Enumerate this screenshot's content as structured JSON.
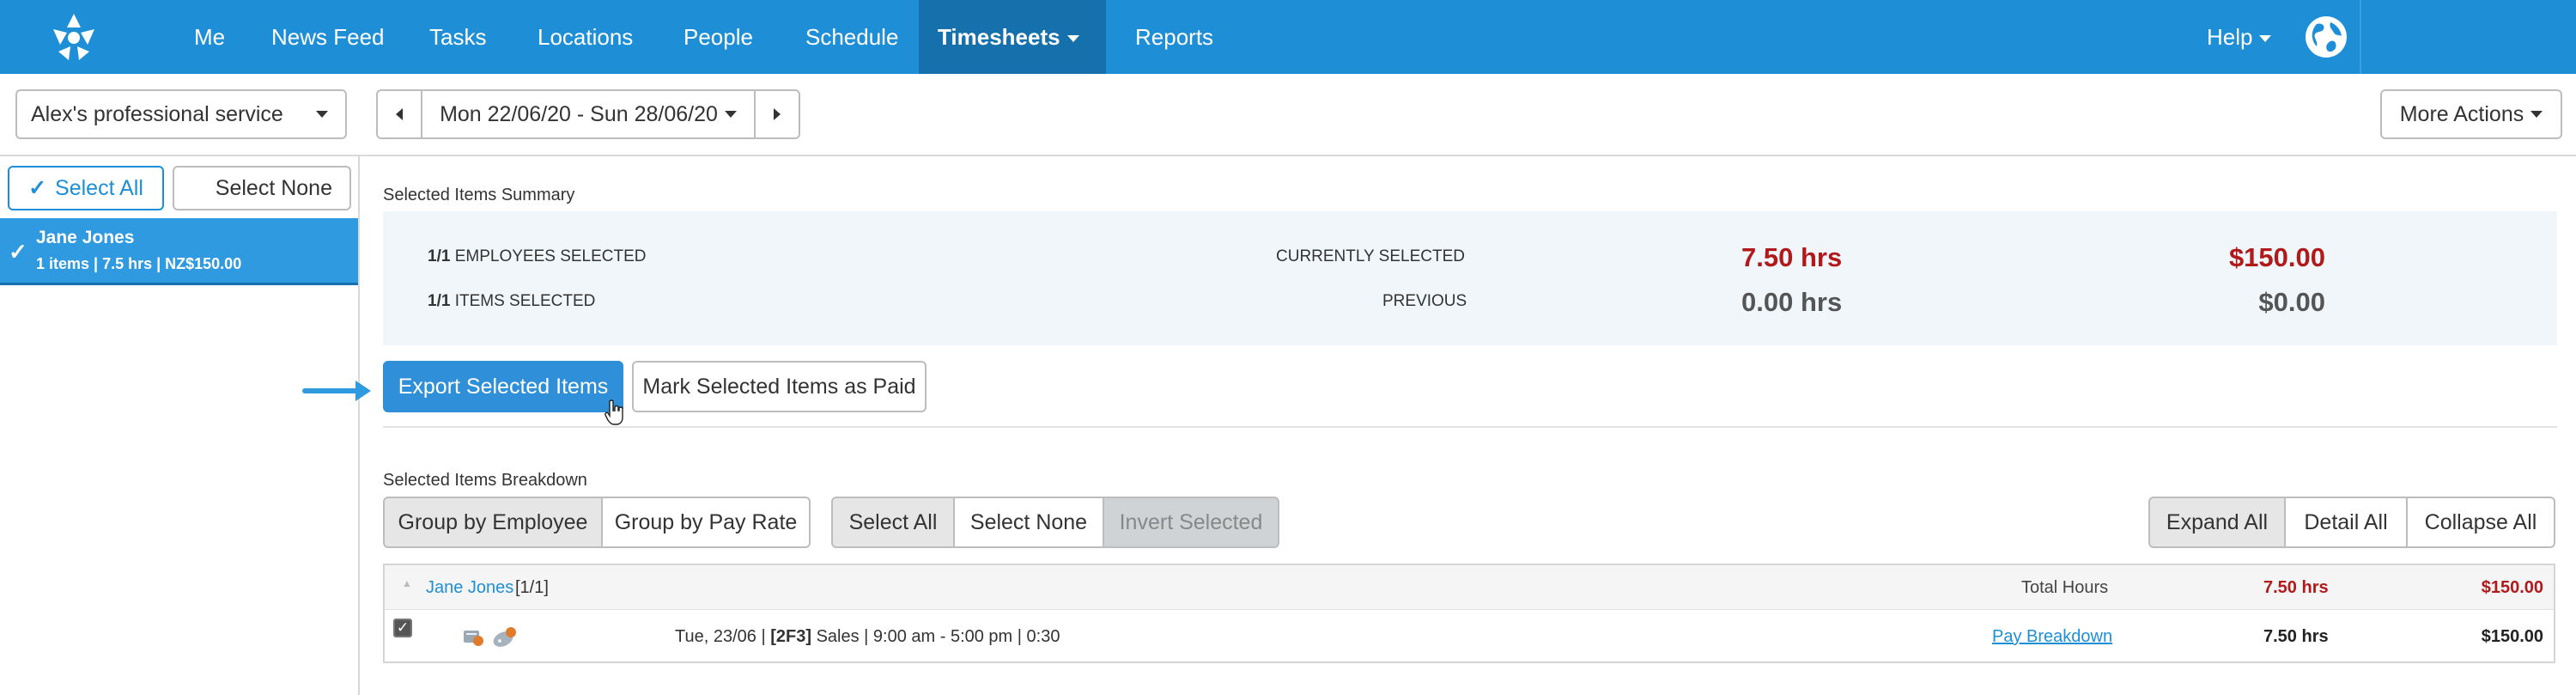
{
  "nav": {
    "items": [
      {
        "label": "Me"
      },
      {
        "label": "News Feed"
      },
      {
        "label": "Tasks"
      },
      {
        "label": "Locations"
      },
      {
        "label": "People"
      },
      {
        "label": "Schedule"
      },
      {
        "label": "Timesheets",
        "active": true,
        "dropdown": true
      },
      {
        "label": "Reports"
      }
    ],
    "help_label": "Help",
    "brand_color": "#1e8fd6",
    "active_color": "#1670ac"
  },
  "toolbar": {
    "business_select": "Alex's professional service",
    "date_range": "Mon 22/06/20 - Sun 28/06/20",
    "more_actions": "More Actions"
  },
  "sidebar": {
    "select_all": "Select All",
    "select_none": "Select None",
    "employees": [
      {
        "name": "Jane Jones",
        "summary": "1 items | 7.5 hrs | NZ$150.00",
        "selected": true
      }
    ]
  },
  "summary": {
    "title": "Selected Items Summary",
    "employees_count": "1/1",
    "employees_label": "Employees Selected",
    "items_count": "1/1",
    "items_label": "Items Selected",
    "currently_label": "Currently Selected",
    "previous_label": "Previous",
    "current_hours": "7.50 hrs",
    "current_amount": "$150.00",
    "previous_hours": "0.00 hrs",
    "previous_amount": "$0.00",
    "highlight_color": "#b01a1a"
  },
  "actions": {
    "export": "Export Selected Items",
    "mark_paid": "Mark Selected Items as Paid"
  },
  "breakdown": {
    "title": "Selected Items Breakdown",
    "group_by_employee": "Group by Employee",
    "group_by_pay_rate": "Group by Pay Rate",
    "select_all": "Select All",
    "select_none": "Select None",
    "invert_selected": "Invert Selected",
    "expand_all": "Expand All",
    "detail_all": "Detail All",
    "collapse_all": "Collapse All",
    "group": {
      "employee": "Jane Jones",
      "count": "[1/1]",
      "total_label": "Total Hours",
      "total_hours": "7.50 hrs",
      "total_amount": "$150.00"
    },
    "rows": [
      {
        "date": "Tue, 23/06 |",
        "code": "[2F3]",
        "detail": "Sales | 9:00 am - 5:00 pm | 0:30",
        "pay_breakdown": "Pay Breakdown",
        "hours": "7.50 hrs",
        "amount": "$150.00",
        "checked": true
      }
    ]
  }
}
